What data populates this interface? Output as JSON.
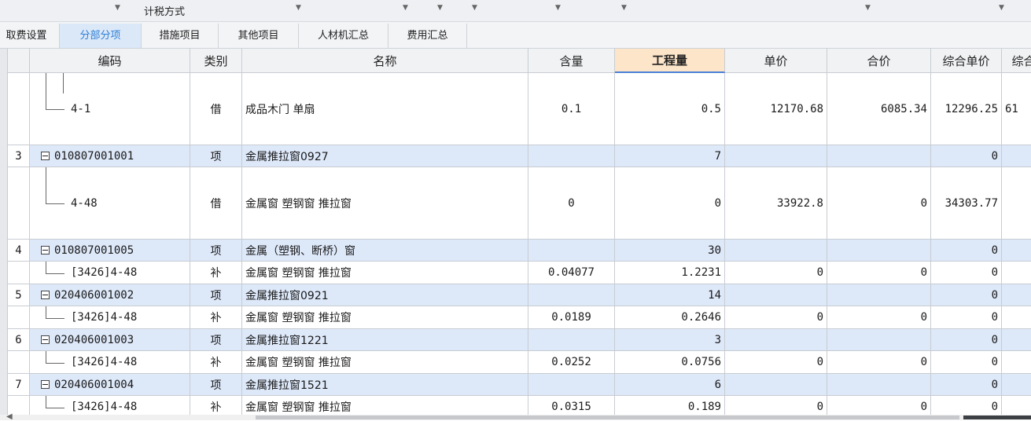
{
  "topbar": {
    "label": "计税方式"
  },
  "tabs": [
    {
      "label": "取费设置",
      "active": false
    },
    {
      "label": "分部分项",
      "active": true
    },
    {
      "label": "措施项目",
      "active": false
    },
    {
      "label": "其他项目",
      "active": false
    },
    {
      "label": "人材机汇总",
      "active": false
    },
    {
      "label": "费用汇总",
      "active": false
    }
  ],
  "table": {
    "headers": [
      "编码",
      "类别",
      "名称",
      "含量",
      "工程量",
      "单价",
      "合价",
      "综合单价",
      "综合"
    ],
    "rows": [
      {
        "type": "sub",
        "index": "",
        "code": "4-1",
        "category": "借",
        "name": "成品木门 单扇",
        "content": "0.1",
        "qty": "0.5",
        "price": "12170.68",
        "total": "6085.34",
        "unit_price": "12296.25",
        "composite": "61"
      },
      {
        "type": "item",
        "index": "3",
        "code": "010807001001",
        "category": "项",
        "name": "金属推拉窗0927",
        "content": "",
        "qty": "7",
        "price": "",
        "total": "",
        "unit_price": "0",
        "composite": ""
      },
      {
        "type": "sub",
        "index": "",
        "code": "4-48",
        "category": "借",
        "name": "金属窗 塑钢窗 推拉窗",
        "content": "0",
        "qty": "0",
        "price": "33922.8",
        "total": "0",
        "unit_price": "34303.77",
        "composite": ""
      },
      {
        "type": "item",
        "index": "4",
        "code": "010807001005",
        "category": "项",
        "name": "金属（塑钢、断桥）窗",
        "content": "",
        "qty": "30",
        "price": "",
        "total": "",
        "unit_price": "0",
        "composite": ""
      },
      {
        "type": "sub",
        "index": "",
        "code": "[3426]4-48",
        "category": "补",
        "name": "金属窗 塑钢窗 推拉窗",
        "content": "0.04077",
        "qty": "1.2231",
        "price": "0",
        "total": "0",
        "unit_price": "0",
        "composite": ""
      },
      {
        "type": "item",
        "index": "5",
        "code": "020406001002",
        "category": "项",
        "name": "金属推拉窗0921",
        "content": "",
        "qty": "14",
        "price": "",
        "total": "",
        "unit_price": "0",
        "composite": ""
      },
      {
        "type": "sub",
        "index": "",
        "code": "[3426]4-48",
        "category": "补",
        "name": "金属窗 塑钢窗 推拉窗",
        "content": "0.0189",
        "qty": "0.2646",
        "price": "0",
        "total": "0",
        "unit_price": "0",
        "composite": ""
      },
      {
        "type": "item",
        "index": "6",
        "code": "020406001003",
        "category": "项",
        "name": "金属推拉窗1221",
        "content": "",
        "qty": "3",
        "price": "",
        "total": "",
        "unit_price": "0",
        "composite": ""
      },
      {
        "type": "sub",
        "index": "",
        "code": "[3426]4-48",
        "category": "补",
        "name": "金属窗 塑钢窗 推拉窗",
        "content": "0.0252",
        "qty": "0.0756",
        "price": "0",
        "total": "0",
        "unit_price": "0",
        "composite": ""
      },
      {
        "type": "item",
        "index": "7",
        "code": "020406001004",
        "category": "项",
        "name": "金属推拉窗1521",
        "content": "",
        "qty": "6",
        "price": "",
        "total": "",
        "unit_price": "0",
        "composite": ""
      },
      {
        "type": "sub",
        "index": "",
        "code": "[3426]4-48",
        "category": "补",
        "name": "金属窗 塑钢窗 推拉窗",
        "content": "0.0315",
        "qty": "0.189",
        "price": "0",
        "total": "0",
        "unit_price": "0",
        "composite": ""
      }
    ]
  },
  "colors": {
    "item_row_bg": "#dde8f9",
    "active_tab_text": "#2f7fd6",
    "highlight_header": "#fde5c9"
  },
  "icons": {
    "collapse": "minus-box-icon",
    "dropdown": "caret-down-icon",
    "scroll_left": "arrow-left-icon"
  }
}
